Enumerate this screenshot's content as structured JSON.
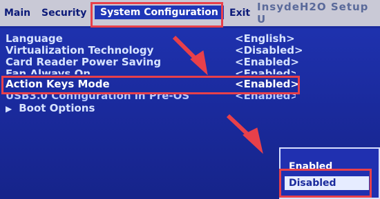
{
  "menu": {
    "items": [
      "Main",
      "Security",
      "System Configuration",
      "Exit"
    ],
    "title_fragment": "InsydeH2O Setup U"
  },
  "settings": [
    {
      "label": "Language",
      "value": "<English>"
    },
    {
      "label": "Virtualization Technology",
      "value": "<Disabled>"
    },
    {
      "label": "Card Reader Power Saving",
      "value": "<Enabled>"
    },
    {
      "label": "Fan Always On",
      "value": "<Enabled>"
    },
    {
      "label": "Action Keys Mode",
      "value": "<Enabled>"
    },
    {
      "label": "USB3.0 Configuration in Pre-OS",
      "value": "<Enabled>"
    }
  ],
  "submenu": {
    "label": "Boot Options"
  },
  "popup": {
    "options": [
      "Enabled",
      "Disabled"
    ],
    "highlighted": "Disabled"
  },
  "colors": {
    "annotation": "#e8404a",
    "background": "#1b2aa0",
    "menubar": "#c9c9d6"
  }
}
